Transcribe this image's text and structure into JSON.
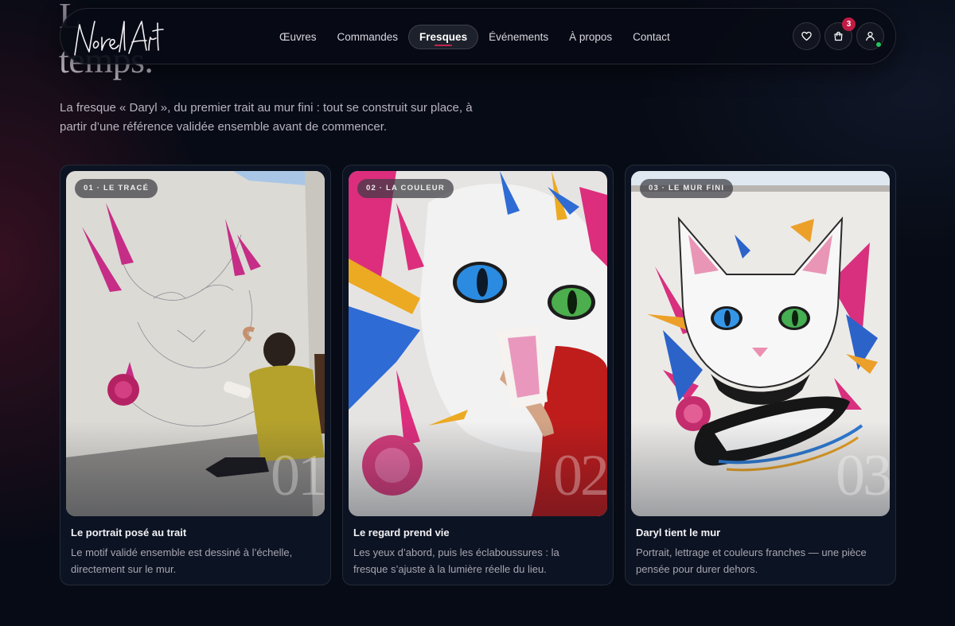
{
  "hero": {
    "heading_top": "L",
    "heading_bottom": "temps."
  },
  "intro": {
    "text": "La fresque « Daryl », du premier trait au mur fini : tout se construit sur place, à partir d’une référence validée ensemble avant de commencer."
  },
  "nav": {
    "logo_text": "Norel Art",
    "links": [
      {
        "label": "Œuvres",
        "active": false
      },
      {
        "label": "Commandes",
        "active": false
      },
      {
        "label": "Fresques",
        "active": true
      },
      {
        "label": "Événements",
        "active": false
      },
      {
        "label": "À propos",
        "active": false
      },
      {
        "label": "Contact",
        "active": false
      }
    ],
    "icons": {
      "favorites": "heart-icon",
      "cart": "shopping-bag-icon",
      "account": "user-icon"
    },
    "cart_count": "3"
  },
  "cards": [
    {
      "badge": "01 · LE TRACÉ",
      "number": "01",
      "title": "Le portrait posé au trait",
      "description": "Le motif validé ensemble est dessiné à l’échelle, directement sur le mur."
    },
    {
      "badge": "02 · LA COULEUR",
      "number": "02",
      "title": "Le regard prend vie",
      "description": "Les yeux d’abord, puis les éclaboussures : la fresque s’ajuste à la lumière réelle du lieu."
    },
    {
      "badge": "03 · LE MUR FINI",
      "number": "03",
      "title": "Daryl tient le mur",
      "description": "Portrait, lettrage et couleurs franches — une pièce pensée pour durer dehors."
    }
  ],
  "colors": {
    "background": "#070b15",
    "accent": "#c11b44",
    "online": "#22c55e",
    "card": "#0c1322"
  }
}
